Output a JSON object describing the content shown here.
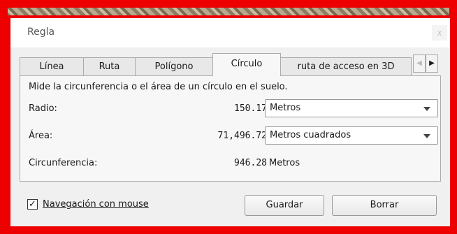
{
  "window": {
    "title": "Regla",
    "close_glyph": "x"
  },
  "tabs": [
    {
      "label": "Línea",
      "active": false
    },
    {
      "label": "Ruta",
      "active": false
    },
    {
      "label": "Polígono",
      "active": false
    },
    {
      "label": "Círculo",
      "active": true
    },
    {
      "label": "ruta de acceso en 3D",
      "active": false
    }
  ],
  "tab_scroll": {
    "left_glyph": "◀",
    "right_glyph": "▶"
  },
  "panel": {
    "description": "Mide la circunferencia o el área de un círculo en el suelo.",
    "radius": {
      "label": "Radio:",
      "value": "150.17",
      "unit": "Metros"
    },
    "area": {
      "label": "Área:",
      "value": "71,496.72",
      "unit": "Metros cuadrados"
    },
    "circumference": {
      "label": "Circunferencia:",
      "value": "946.28",
      "unit": "Metros"
    }
  },
  "footer": {
    "mouse_nav": {
      "label": "Navegación con mouse",
      "checked": true,
      "check_glyph": "✓"
    },
    "save_label": "Guardar",
    "clear_label": "Borrar"
  },
  "colors": {
    "highlight_border": "#ee0000",
    "dialog_bg": "#f0f0f0"
  }
}
